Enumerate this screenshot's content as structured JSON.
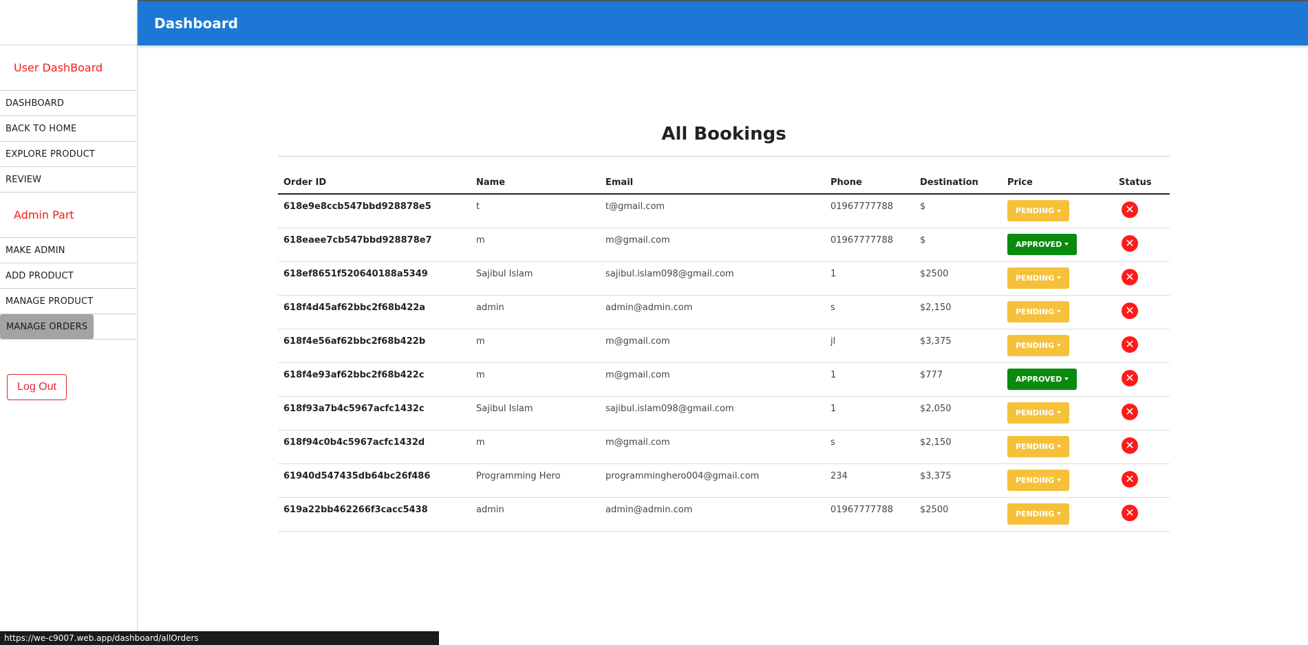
{
  "header": {
    "title": "Dashboard"
  },
  "sidebar": {
    "user_section": "User DashBoard",
    "user_items": [
      {
        "label": "DASHBOARD"
      },
      {
        "label": "BACK TO HOME"
      },
      {
        "label": "EXPLORE PRODUCT"
      },
      {
        "label": "REVIEW"
      }
    ],
    "admin_section": "Admin Part",
    "admin_items": [
      {
        "label": "MAKE ADMIN"
      },
      {
        "label": "ADD PRODUCT"
      },
      {
        "label": "MANAGE PRODUCT"
      },
      {
        "label": "MANAGE ORDERS"
      }
    ],
    "logout_label": "Log Out"
  },
  "main": {
    "title": "All Bookings",
    "columns": [
      "Order ID",
      "Name",
      "Email",
      "Phone",
      "Destination",
      "Price",
      "Status"
    ],
    "rows": [
      {
        "id": "618e9e8ccb547bbd928878e5",
        "name": "t",
        "email": "t@gmail.com",
        "phone": "01967777788",
        "destination": "$",
        "status": "PENDING",
        "delete_icon": "✕"
      },
      {
        "id": "618eaee7cb547bbd928878e7",
        "name": "m",
        "email": "m@gmail.com",
        "phone": "01967777788",
        "destination": "$",
        "status": "APPROVED",
        "delete_icon": "✕"
      },
      {
        "id": "618ef8651f520640188a5349",
        "name": "Sajibul Islam",
        "email": "sajibul.islam098@gmail.com",
        "phone": "1",
        "destination": "$2500",
        "status": "PENDING",
        "delete_icon": "✕"
      },
      {
        "id": "618f4d45af62bbc2f68b422a",
        "name": "admin",
        "email": "admin@admin.com",
        "phone": "s",
        "destination": "$2,150",
        "status": "PENDING",
        "delete_icon": "✕"
      },
      {
        "id": "618f4e56af62bbc2f68b422b",
        "name": "m",
        "email": "m@gmail.com",
        "phone": "jl",
        "destination": "$3,375",
        "status": "PENDING",
        "delete_icon": "✕"
      },
      {
        "id": "618f4e93af62bbc2f68b422c",
        "name": "m",
        "email": "m@gmail.com",
        "phone": "1",
        "destination": "$777",
        "status": "APPROVED",
        "delete_icon": "✕"
      },
      {
        "id": "618f93a7b4c5967acfc1432c",
        "name": "Sajibul Islam",
        "email": "sajibul.islam098@gmail.com",
        "phone": "1",
        "destination": "$2,050",
        "status": "PENDING",
        "delete_icon": "✕"
      },
      {
        "id": "618f94c0b4c5967acfc1432d",
        "name": "m",
        "email": "m@gmail.com",
        "phone": "s",
        "destination": "$2,150",
        "status": "PENDING",
        "delete_icon": "✕"
      },
      {
        "id": "61940d547435db64bc26f486",
        "name": "Programming Hero",
        "email": "programminghero004@gmail.com",
        "phone": "234",
        "destination": "$3,375",
        "status": "PENDING",
        "delete_icon": "✕"
      },
      {
        "id": "619a22bb462266f3cacc5438",
        "name": "admin",
        "email": "admin@admin.com",
        "phone": "01967777788",
        "destination": "$2500",
        "status": "PENDING",
        "delete_icon": "✕"
      }
    ]
  },
  "statusbar": {
    "url": "https://we-c9007.web.app/dashboard/allOrders"
  },
  "colors": {
    "header": "#1c78d4",
    "pending": "#f6c13a",
    "approved": "#0a8a0f",
    "delete": "#ff1a1a",
    "section_title": "#f11b1b"
  },
  "icons": {
    "status_caret": "caret-down-icon",
    "delete": "close-circle-icon"
  }
}
